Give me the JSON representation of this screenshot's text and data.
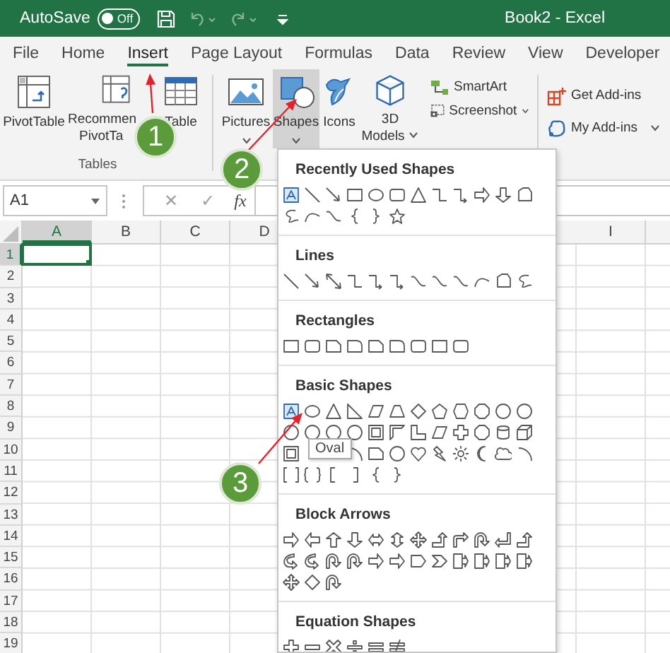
{
  "title_bar": {
    "autosave_label": "AutoSave",
    "autosave_toggle": {
      "label": "Off",
      "on": false
    },
    "undo": {
      "disabled": true
    },
    "redo": {
      "disabled": true
    },
    "title": "Book2 - Excel"
  },
  "tabs": [
    {
      "label": "File",
      "selected": false
    },
    {
      "label": "Home",
      "selected": false
    },
    {
      "label": "Insert",
      "selected": true
    },
    {
      "label": "Page Layout",
      "selected": false
    },
    {
      "label": "Formulas",
      "selected": false
    },
    {
      "label": "Data",
      "selected": false
    },
    {
      "label": "Review",
      "selected": false
    },
    {
      "label": "View",
      "selected": false
    },
    {
      "label": "Developer",
      "selected": false
    }
  ],
  "ribbon": {
    "pivot_table": "PivotTable",
    "recommended_pivot_tables": [
      "Recommen",
      "PivotTa"
    ],
    "table": "Table",
    "tables_group": "Tables",
    "pictures": "Pictures",
    "shapes": {
      "label": "Shapes",
      "selected": true
    },
    "icons": "Icons",
    "models_3d": [
      "3D",
      "Models"
    ],
    "smartart": "SmartArt",
    "screenshot": "Screenshot",
    "get_add_ins": "Get Add-ins",
    "my_add_ins": "My Add-ins"
  },
  "formula_bar": {
    "name_box": "A1",
    "cancel": "✕",
    "enter": "✓",
    "function": "fx"
  },
  "sheet": {
    "columns": [
      {
        "label": "A",
        "selected": true
      },
      {
        "label": "B",
        "selected": false
      },
      {
        "label": "C",
        "selected": false
      },
      {
        "label": "D",
        "selected": false
      },
      {
        "label": "I",
        "selected": false
      }
    ],
    "rows": [
      {
        "label": "1",
        "selected": true
      },
      {
        "label": "2",
        "selected": false
      },
      {
        "label": "3",
        "selected": false
      },
      {
        "label": "4",
        "selected": false
      },
      {
        "label": "5",
        "selected": false
      },
      {
        "label": "6",
        "selected": false
      },
      {
        "label": "7",
        "selected": false
      },
      {
        "label": "8",
        "selected": false
      },
      {
        "label": "9",
        "selected": false
      },
      {
        "label": "10",
        "selected": false
      },
      {
        "label": "11",
        "selected": false
      },
      {
        "label": "12",
        "selected": false
      },
      {
        "label": "13",
        "selected": false
      },
      {
        "label": "14",
        "selected": false
      },
      {
        "label": "15",
        "selected": false
      },
      {
        "label": "16",
        "selected": false
      },
      {
        "label": "17",
        "selected": false
      },
      {
        "label": "18",
        "selected": false
      },
      {
        "label": "19",
        "selected": false
      }
    ]
  },
  "shapes_menu": {
    "sections": [
      {
        "title": "Recently Used Shapes"
      },
      {
        "title": "Lines"
      },
      {
        "title": "Rectangles"
      },
      {
        "title": "Basic Shapes"
      },
      {
        "title": "Block Arrows"
      },
      {
        "title": "Equation Shapes"
      }
    ],
    "tooltip": "Oval"
  },
  "annotations": [
    {
      "number": "1"
    },
    {
      "number": "2"
    },
    {
      "number": "3"
    }
  ]
}
